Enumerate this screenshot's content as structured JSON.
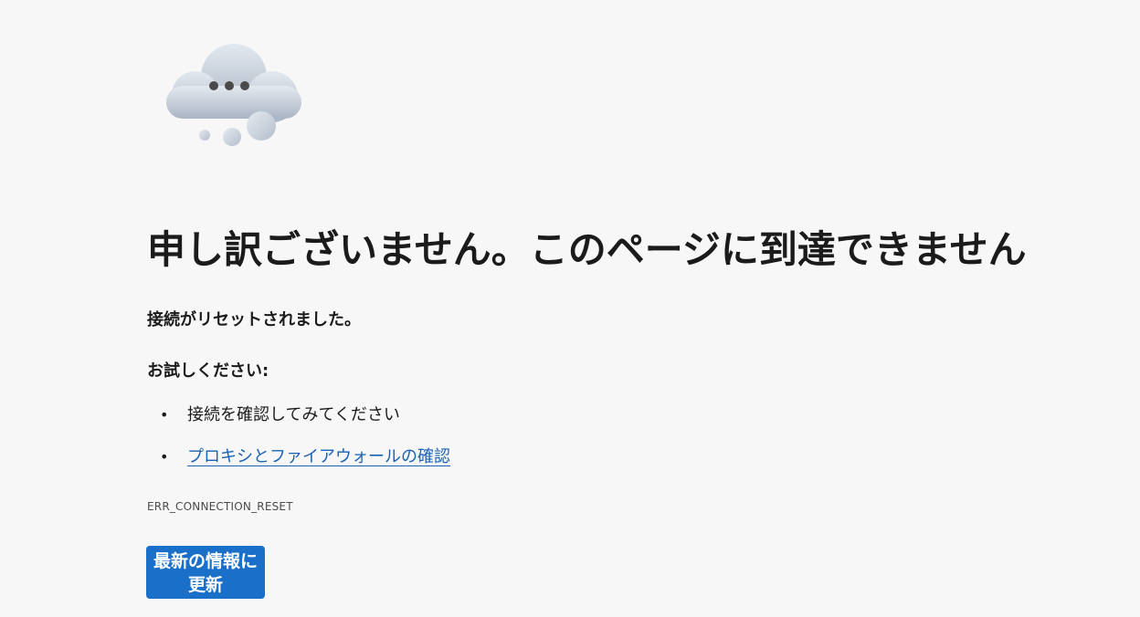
{
  "error_page": {
    "icon": "cloud-thinking-icon",
    "title": "申し訳ございません。このページに到達できません",
    "subtitle": "接続がリセットされました。",
    "try_heading": "お試しください:",
    "suggestions": [
      {
        "text": "接続を確認してみてください",
        "is_link": false
      },
      {
        "text": "プロキシとファイアウォールの確認",
        "is_link": true
      }
    ],
    "error_code": "ERR_CONNECTION_RESET",
    "refresh_button_label": "最新の情報に更新"
  },
  "colors": {
    "background": "#f7f7f7",
    "link": "#1a62b4",
    "button": "#1a6fc9"
  }
}
